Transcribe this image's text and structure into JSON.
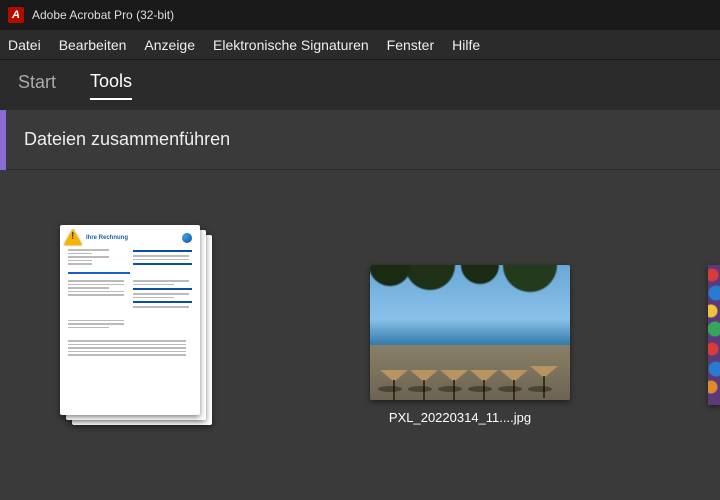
{
  "window": {
    "title": "Adobe Acrobat Pro (32-bit)"
  },
  "menu": {
    "items": [
      "Datei",
      "Bearbeiten",
      "Anzeige",
      "Elektronische Signaturen",
      "Fenster",
      "Hilfe"
    ]
  },
  "tabs": {
    "start": "Start",
    "tools": "Tools",
    "active": "tools"
  },
  "tool": {
    "name": "Dateien zusammenführen"
  },
  "files": [
    {
      "label": "",
      "doc_heading": "Ihre Rechnung",
      "type": "pdf-stack"
    },
    {
      "label": "PXL_20220314_11....jpg",
      "type": "photo"
    }
  ]
}
